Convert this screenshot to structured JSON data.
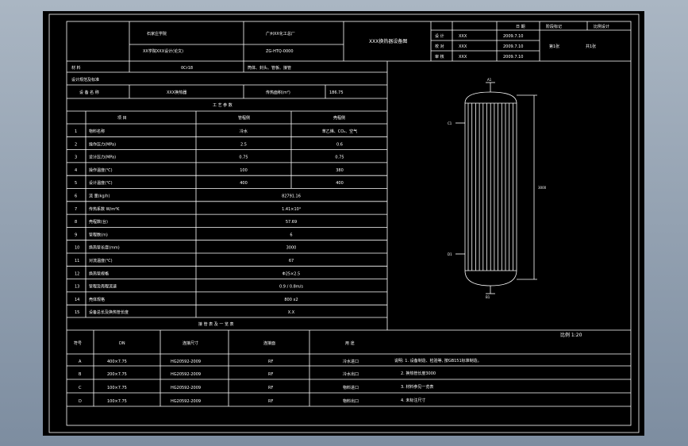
{
  "title_block": {
    "school": "石家庄学院",
    "design_label": "XX学院XXX设计(论文)",
    "company": "广州XX化工总厂",
    "drawing_no": "ZG-HTQ-0000",
    "doc_title": "XXX换热器设备图",
    "sign_rows": [
      {
        "role": "设 计",
        "name": "XXX",
        "date": "2009.7.10"
      },
      {
        "role": "校 对",
        "name": "XXX",
        "date": "2009.7.10"
      },
      {
        "role": "审 核",
        "name": "XXX",
        "date": "2009.7.10"
      }
    ],
    "header_date": "日 期",
    "stage_label": "阶段标记",
    "ratio_label": "比例设计",
    "sheet_label": "第1张",
    "sheet_total": "共1张"
  },
  "spec": {
    "material_label": "材 料",
    "material_value": "0Cr18",
    "parts_text": "筒体、封头、管板、接管",
    "code_label": "设计规范及标准",
    "item_name_label": "设 备 名 称",
    "item_name_value": "XXX换热器",
    "area_label": "传热面积(m²)",
    "area_value": "186.75",
    "process_title": "工 艺 参 数",
    "col_item": "项  目",
    "col_shell": "管程侧",
    "col_tube": "壳程侧",
    "rows": [
      {
        "no": "1",
        "label": "物料名称",
        "shell": "冷水",
        "tube": "苯乙烯、CO₂、空气"
      },
      {
        "no": "2",
        "label": "操作压力(MPa)",
        "shell": "2.5",
        "tube": "0.6"
      },
      {
        "no": "3",
        "label": "设计压力(MPa)",
        "shell": "0.75",
        "tube": "0.75"
      },
      {
        "no": "4",
        "label": "操作温度(℃)",
        "shell": "100",
        "tube": "380"
      },
      {
        "no": "5",
        "label": "设计温度(℃)",
        "shell": "400",
        "tube": "400"
      },
      {
        "no": "6",
        "label": "流 量(kg/h)",
        "merged": "82791.16"
      },
      {
        "no": "7",
        "label": "传热系数 W/m²K",
        "merged": "1.41×10⁴"
      },
      {
        "no": "8",
        "label": "壳程数(台)",
        "merged": "57.69"
      },
      {
        "no": "9",
        "label": "管程数(m)",
        "merged": "6"
      },
      {
        "no": "10",
        "label": "换热管长度(mm)",
        "merged": "3000"
      },
      {
        "no": "11",
        "label": "对流温度(℃)",
        "merged": "67"
      },
      {
        "no": "12",
        "label": "换热管规格",
        "merged": "Φ25×2.5"
      },
      {
        "no": "13",
        "label": "管程及壳程流速",
        "merged": "0.9 / 0.8m/s"
      },
      {
        "no": "14",
        "label": "壳体规格",
        "merged": "800 x2"
      },
      {
        "no": "15",
        "label": "设备总长及换热管长度",
        "merged": "X.X"
      }
    ],
    "nozzle_title": "接 管 表 及 一 览 表",
    "nozzle_headers": [
      "符号",
      "DN",
      "连接尺寸",
      "连接面",
      "用 途"
    ],
    "nozzles": [
      {
        "sym": "A",
        "dn": "400×7.75",
        "std": "HG20592-2009",
        "face": "RF",
        "use": "冷水进口"
      },
      {
        "sym": "B",
        "dn": "200×7.75",
        "std": "HG20592-2009",
        "face": "RF",
        "use": "冷水出口"
      },
      {
        "sym": "C",
        "dn": "100×7.75",
        "std": "HG20592-2009",
        "face": "RF",
        "use": "物料进口"
      },
      {
        "sym": "D",
        "dn": "100×7.75",
        "std": "HG20592-2009",
        "face": "RF",
        "use": "物料出口"
      }
    ]
  },
  "notes": [
    "说明: 1. 设备制造、检验等, 按GB151标准制造。",
    "2. 换热管长度3000",
    "3. 材料参见一览表",
    "4. 未标注尺寸"
  ],
  "drawing": {
    "scale_text": "比例 1:20",
    "label_top": "A1",
    "label_left_top": "C1",
    "label_left_bottom": "D1",
    "label_bottom": "B1",
    "label_right": "3000"
  }
}
